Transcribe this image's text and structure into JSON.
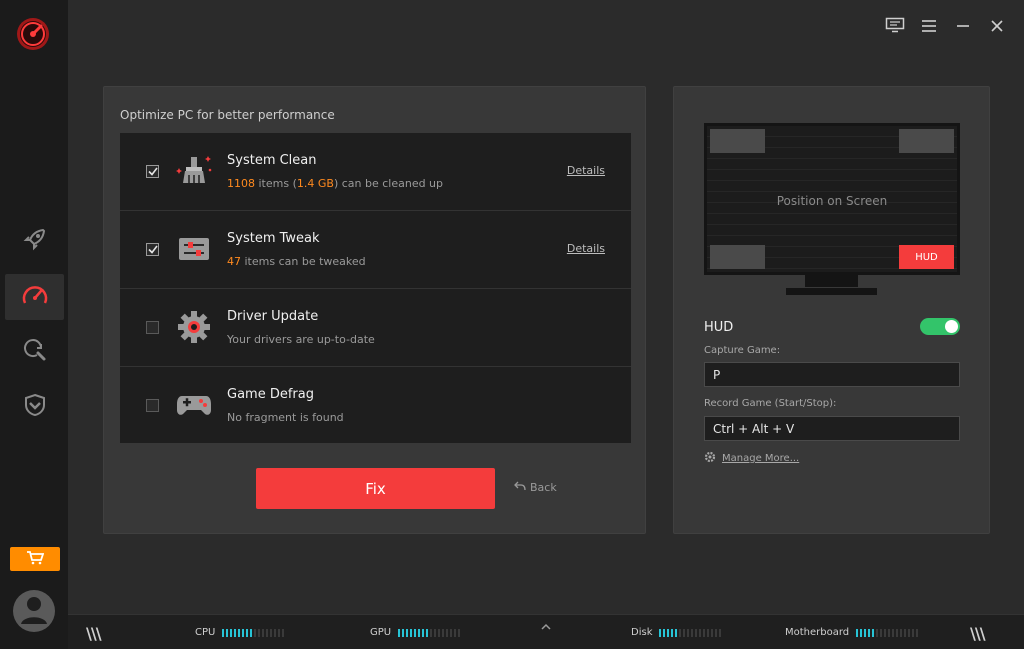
{
  "colors": {
    "accent": "#f43c3c",
    "orange": "#ff8a1f",
    "toggle_on": "#33c46a",
    "meter": "#27c4d6"
  },
  "sidebar": {
    "items": [
      {
        "icon": "rocket-icon",
        "name": "sidebar-item-boost",
        "active": false
      },
      {
        "icon": "speedometer-icon",
        "name": "sidebar-item-optimize",
        "active": true
      },
      {
        "icon": "search-refresh-icon",
        "name": "sidebar-item-scan",
        "active": false
      },
      {
        "icon": "shield-icon",
        "name": "sidebar-item-protect",
        "active": false
      }
    ]
  },
  "main": {
    "title": "Optimize PC for better performance",
    "rows": [
      {
        "title": "System Clean",
        "sub_highlight": "1108",
        "sub_text1": " items (",
        "sub_highlight2": "1.4 GB",
        "sub_text2": ") can be cleaned up",
        "details": "Details",
        "checked": true
      },
      {
        "title": "System Tweak",
        "sub_highlight": "47",
        "sub_text1": " items can be tweaked",
        "details": "Details",
        "checked": true
      },
      {
        "title": "Driver Update",
        "sub_text": "Your drivers are up-to-date",
        "checked": false
      },
      {
        "title": "Game Defrag",
        "sub_text": "No fragment is found",
        "checked": false
      }
    ],
    "fix_label": "Fix",
    "back_label": "Back"
  },
  "hud": {
    "screen_label": "Position on Screen",
    "badge": "HUD",
    "label": "HUD",
    "enabled": true,
    "capture_label": "Capture Game:",
    "capture_value": "P",
    "record_label": "Record Game (Start/Stop):",
    "record_value": "Ctrl + Alt + V",
    "manage_label": "Manage More..."
  },
  "footer": {
    "metrics": [
      {
        "label": "CPU",
        "level": 0.5
      },
      {
        "label": "GPU",
        "level": 0.5
      },
      {
        "label": "Disk",
        "level": 0.3
      },
      {
        "label": "Motherboard",
        "level": 0.3
      }
    ]
  }
}
